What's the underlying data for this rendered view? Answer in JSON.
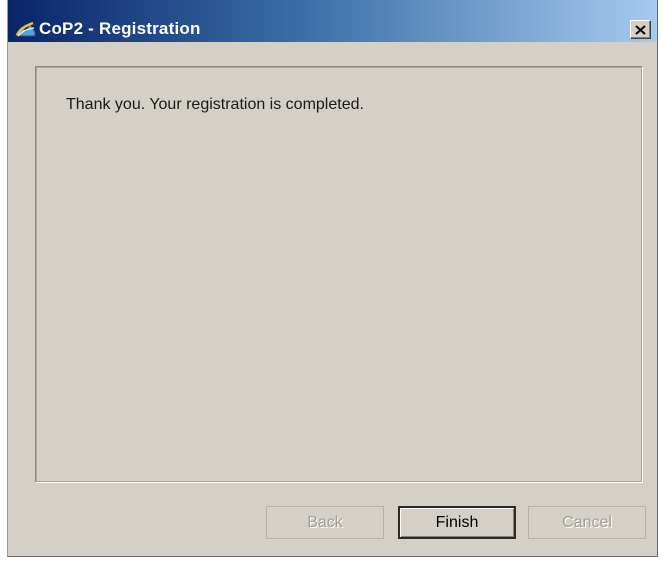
{
  "window": {
    "title": "CoP2 - Registration",
    "app_icon": "cop2-app-icon",
    "close_icon": "close-icon",
    "close_label": "×"
  },
  "content": {
    "message": "Thank you. Your registration is completed."
  },
  "buttons": {
    "back": {
      "label": "Back",
      "enabled": false
    },
    "finish": {
      "label": "Finish",
      "enabled": true,
      "default": true
    },
    "cancel": {
      "label": "Cancel",
      "enabled": false
    }
  },
  "colors": {
    "title_bar_start": "#0a246a",
    "title_bar_end": "#a6caf0",
    "window_bg": "#d4d0c8"
  }
}
